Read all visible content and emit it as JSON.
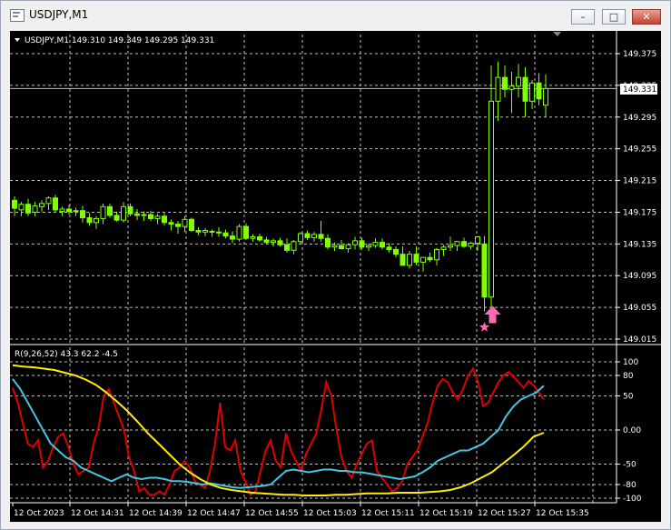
{
  "window": {
    "title": "USDJPY,M1",
    "minimize_glyph": "–",
    "maximize_glyph": "□",
    "close_glyph": "✕"
  },
  "chart": {
    "info": "USDJPY,M1  149.310 149.349 149.295 149.331",
    "current_price_label": "149.331",
    "price_axis": [
      "149.375",
      "149.335",
      "149.295",
      "149.255",
      "149.215",
      "149.175",
      "149.135",
      "149.095",
      "149.055",
      "149.015"
    ],
    "indicator_label": "R(9,26,52) 43.3 62.2 -4.5",
    "indicator_axis": [
      "100",
      "80",
      "50",
      "0.00",
      "-50",
      "-80",
      "-100"
    ],
    "time_axis": [
      "12 Oct 2023",
      "12 Oct 14:31",
      "12 Oct 14:39",
      "12 Oct 14:47",
      "12 Oct 14:55",
      "12 Oct 15:03",
      "12 Oct 15:11",
      "12 Oct 15:19",
      "12 Oct 15:27",
      "12 Oct 15:35"
    ],
    "colors": {
      "background": "#000000",
      "grid": "#c0c0c0",
      "up_body": "#000000",
      "candle": "#7fff00",
      "signal": "#ff69b4",
      "red_line": "#e00000",
      "cyan_line": "#40c8e0",
      "yellow_line": "#ffee00"
    },
    "signal_icons": [
      "up-arrow-icon",
      "star-icon"
    ]
  },
  "chart_data": {
    "type": "candlestick",
    "symbol": "USDJPY",
    "timeframe": "M1",
    "ylim": [
      149.015,
      149.395
    ],
    "candles": [
      [
        149.19,
        149.195,
        149.17,
        149.18
      ],
      [
        149.178,
        149.188,
        149.17,
        149.185
      ],
      [
        149.185,
        149.192,
        149.17,
        149.174
      ],
      [
        149.175,
        149.188,
        149.17,
        149.183
      ],
      [
        149.182,
        149.19,
        149.175,
        149.186
      ],
      [
        149.186,
        149.195,
        149.178,
        149.193
      ],
      [
        149.193,
        149.197,
        149.175,
        149.178
      ],
      [
        149.176,
        149.182,
        149.17,
        149.179
      ],
      [
        149.179,
        149.184,
        149.172,
        149.176
      ],
      [
        149.176,
        149.181,
        149.17,
        149.177
      ],
      [
        149.177,
        149.183,
        149.162,
        149.168
      ],
      [
        149.168,
        149.174,
        149.158,
        149.162
      ],
      [
        149.162,
        149.17,
        149.154,
        149.167
      ],
      [
        149.167,
        149.186,
        149.16,
        149.182
      ],
      [
        149.182,
        149.186,
        149.168,
        149.171
      ],
      [
        149.171,
        149.176,
        149.163,
        149.165
      ],
      [
        149.165,
        149.188,
        149.162,
        149.182
      ],
      [
        149.182,
        149.186,
        149.17,
        149.173
      ],
      [
        149.173,
        149.179,
        149.165,
        149.171
      ],
      [
        149.171,
        149.176,
        149.164,
        149.172
      ],
      [
        149.172,
        149.177,
        149.164,
        149.167
      ],
      [
        149.167,
        149.173,
        149.16,
        149.17
      ],
      [
        149.17,
        149.174,
        149.158,
        149.162
      ],
      [
        149.162,
        149.166,
        149.152,
        149.16
      ],
      [
        149.16,
        149.164,
        149.148,
        149.157
      ],
      [
        149.157,
        149.17,
        149.15,
        149.166
      ],
      [
        149.166,
        149.168,
        149.15,
        149.152
      ],
      [
        149.152,
        149.156,
        149.146,
        149.15
      ],
      [
        149.15,
        149.155,
        149.145,
        149.152
      ],
      [
        149.151,
        149.153,
        149.144,
        149.15
      ],
      [
        149.15,
        149.156,
        149.144,
        149.149
      ],
      [
        149.149,
        149.153,
        149.142,
        149.145
      ],
      [
        149.145,
        149.151,
        149.136,
        149.141
      ],
      [
        149.141,
        149.16,
        149.138,
        149.157
      ],
      [
        149.157,
        149.161,
        149.14,
        149.142
      ],
      [
        149.142,
        149.147,
        149.138,
        149.144
      ],
      [
        149.144,
        149.148,
        149.138,
        149.14
      ],
      [
        149.14,
        149.144,
        149.135,
        149.137
      ],
      [
        149.137,
        149.142,
        149.132,
        149.139
      ],
      [
        149.139,
        149.143,
        149.132,
        149.134
      ],
      [
        149.134,
        149.142,
        149.124,
        149.127
      ],
      [
        149.127,
        149.14,
        149.122,
        149.138
      ],
      [
        149.138,
        149.15,
        149.135,
        149.148
      ],
      [
        149.148,
        149.152,
        149.14,
        149.143
      ],
      [
        149.143,
        149.15,
        149.138,
        149.147
      ],
      [
        149.147,
        149.164,
        149.138,
        149.142
      ],
      [
        149.142,
        149.147,
        149.128,
        149.131
      ],
      [
        149.131,
        149.137,
        149.126,
        149.133
      ],
      [
        149.133,
        149.14,
        149.128,
        149.129
      ],
      [
        149.129,
        149.136,
        149.124,
        149.134
      ],
      [
        149.134,
        149.144,
        149.128,
        149.139
      ],
      [
        149.139,
        149.143,
        149.128,
        149.131
      ],
      [
        149.131,
        149.136,
        149.126,
        149.133
      ],
      [
        149.133,
        149.142,
        149.13,
        149.137
      ],
      [
        149.137,
        149.142,
        149.128,
        149.131
      ],
      [
        149.131,
        149.136,
        149.124,
        149.128
      ],
      [
        149.128,
        149.132,
        149.118,
        149.122
      ],
      [
        149.122,
        149.132,
        149.114,
        149.108
      ],
      [
        149.108,
        149.126,
        149.104,
        149.122
      ],
      [
        149.122,
        149.132,
        149.108,
        149.112
      ],
      [
        149.112,
        149.118,
        149.1,
        149.118
      ],
      [
        149.118,
        149.124,
        149.112,
        149.115
      ],
      [
        149.115,
        149.13,
        149.108,
        149.128
      ],
      [
        149.128,
        149.134,
        149.12,
        149.131
      ],
      [
        149.131,
        149.144,
        149.126,
        149.133
      ],
      [
        149.133,
        149.139,
        149.126,
        149.138
      ],
      [
        149.138,
        149.143,
        149.13,
        149.132
      ],
      [
        149.132,
        149.138,
        149.128,
        149.136
      ],
      [
        149.136,
        149.145,
        149.126,
        149.144
      ],
      [
        149.135,
        149.145,
        149.05,
        149.068
      ],
      [
        149.068,
        149.36,
        149.055,
        149.315
      ],
      [
        149.315,
        149.365,
        149.29,
        149.345
      ],
      [
        149.345,
        149.36,
        149.32,
        149.33
      ],
      [
        149.33,
        149.352,
        149.3,
        149.334
      ],
      [
        149.334,
        149.362,
        149.32,
        149.345
      ],
      [
        149.345,
        149.358,
        149.295,
        149.315
      ],
      [
        149.315,
        149.342,
        149.305,
        149.338
      ],
      [
        149.338,
        149.35,
        149.31,
        149.318
      ],
      [
        149.31,
        149.349,
        149.295,
        149.331
      ]
    ],
    "signal": {
      "type": "buy-arrow",
      "candle_index": 69,
      "price": 149.04
    },
    "indicator": {
      "title": "R(9,26,52)",
      "values": [
        43.3,
        62.2,
        -4.5
      ],
      "ylim": [
        -100,
        100
      ],
      "series": [
        {
          "color": "#e00000",
          "values": [
            62,
            40,
            10,
            -20,
            -25,
            -15,
            -55,
            -45,
            -25,
            -10,
            -5,
            -25,
            -50,
            -65,
            -60,
            -55,
            -20,
            5,
            50,
            60,
            40,
            20,
            0,
            -40,
            -60,
            -90,
            -85,
            -95,
            -95,
            -90,
            -95,
            -80,
            -60,
            -55,
            -45,
            -55,
            -75,
            -80,
            -85,
            -60,
            -20,
            40,
            -25,
            -30,
            -15,
            -60,
            -75,
            -95,
            -90,
            -60,
            -30,
            -15,
            -45,
            -55,
            -5,
            -30,
            -45,
            -60,
            -35,
            -20,
            -5,
            30,
            70,
            50,
            0,
            -40,
            -60,
            -70,
            -50,
            -35,
            -20,
            -15,
            -60,
            -70,
            -80,
            -90,
            -85,
            -75,
            -50,
            -40,
            -30,
            -10,
            10,
            40,
            65,
            75,
            70,
            55,
            45,
            60,
            80,
            90,
            70,
            35,
            40,
            55,
            70,
            80,
            85,
            78,
            70,
            62,
            72,
            65,
            55,
            45
          ]
        },
        {
          "color": "#40c8e0",
          "values": [
            75,
            60,
            40,
            20,
            0,
            -20,
            -30,
            -40,
            -45,
            -55,
            -60,
            -65,
            -70,
            -75,
            -70,
            -65,
            -70,
            -72,
            -70,
            -70,
            -72,
            -75,
            -75,
            -76,
            -78,
            -80,
            -78,
            -80,
            -82,
            -84,
            -85,
            -84,
            -83,
            -82,
            -80,
            -70,
            -60,
            -58,
            -60,
            -62,
            -60,
            -58,
            -58,
            -60,
            -60,
            -62,
            -62,
            -64,
            -66,
            -68,
            -70,
            -72,
            -70,
            -68,
            -62,
            -55,
            -45,
            -40,
            -35,
            -30,
            -30,
            -25,
            -20,
            -10,
            0,
            20,
            35,
            45,
            50,
            55,
            65
          ]
        },
        {
          "color": "#ffee00",
          "values": [
            95,
            93,
            92,
            90,
            88,
            84,
            80,
            74,
            66,
            55,
            42,
            28,
            12,
            -5,
            -20,
            -35,
            -50,
            -62,
            -72,
            -80,
            -85,
            -88,
            -90,
            -92,
            -93,
            -94,
            -95,
            -95,
            -96,
            -96,
            -96,
            -95,
            -95,
            -94,
            -93,
            -93,
            -93,
            -92,
            -92,
            -92,
            -91,
            -90,
            -88,
            -84,
            -78,
            -70,
            -62,
            -50,
            -38,
            -25,
            -10,
            -4
          ]
        }
      ]
    },
    "xlabel": "",
    "ylabel": "",
    "grid": true
  }
}
